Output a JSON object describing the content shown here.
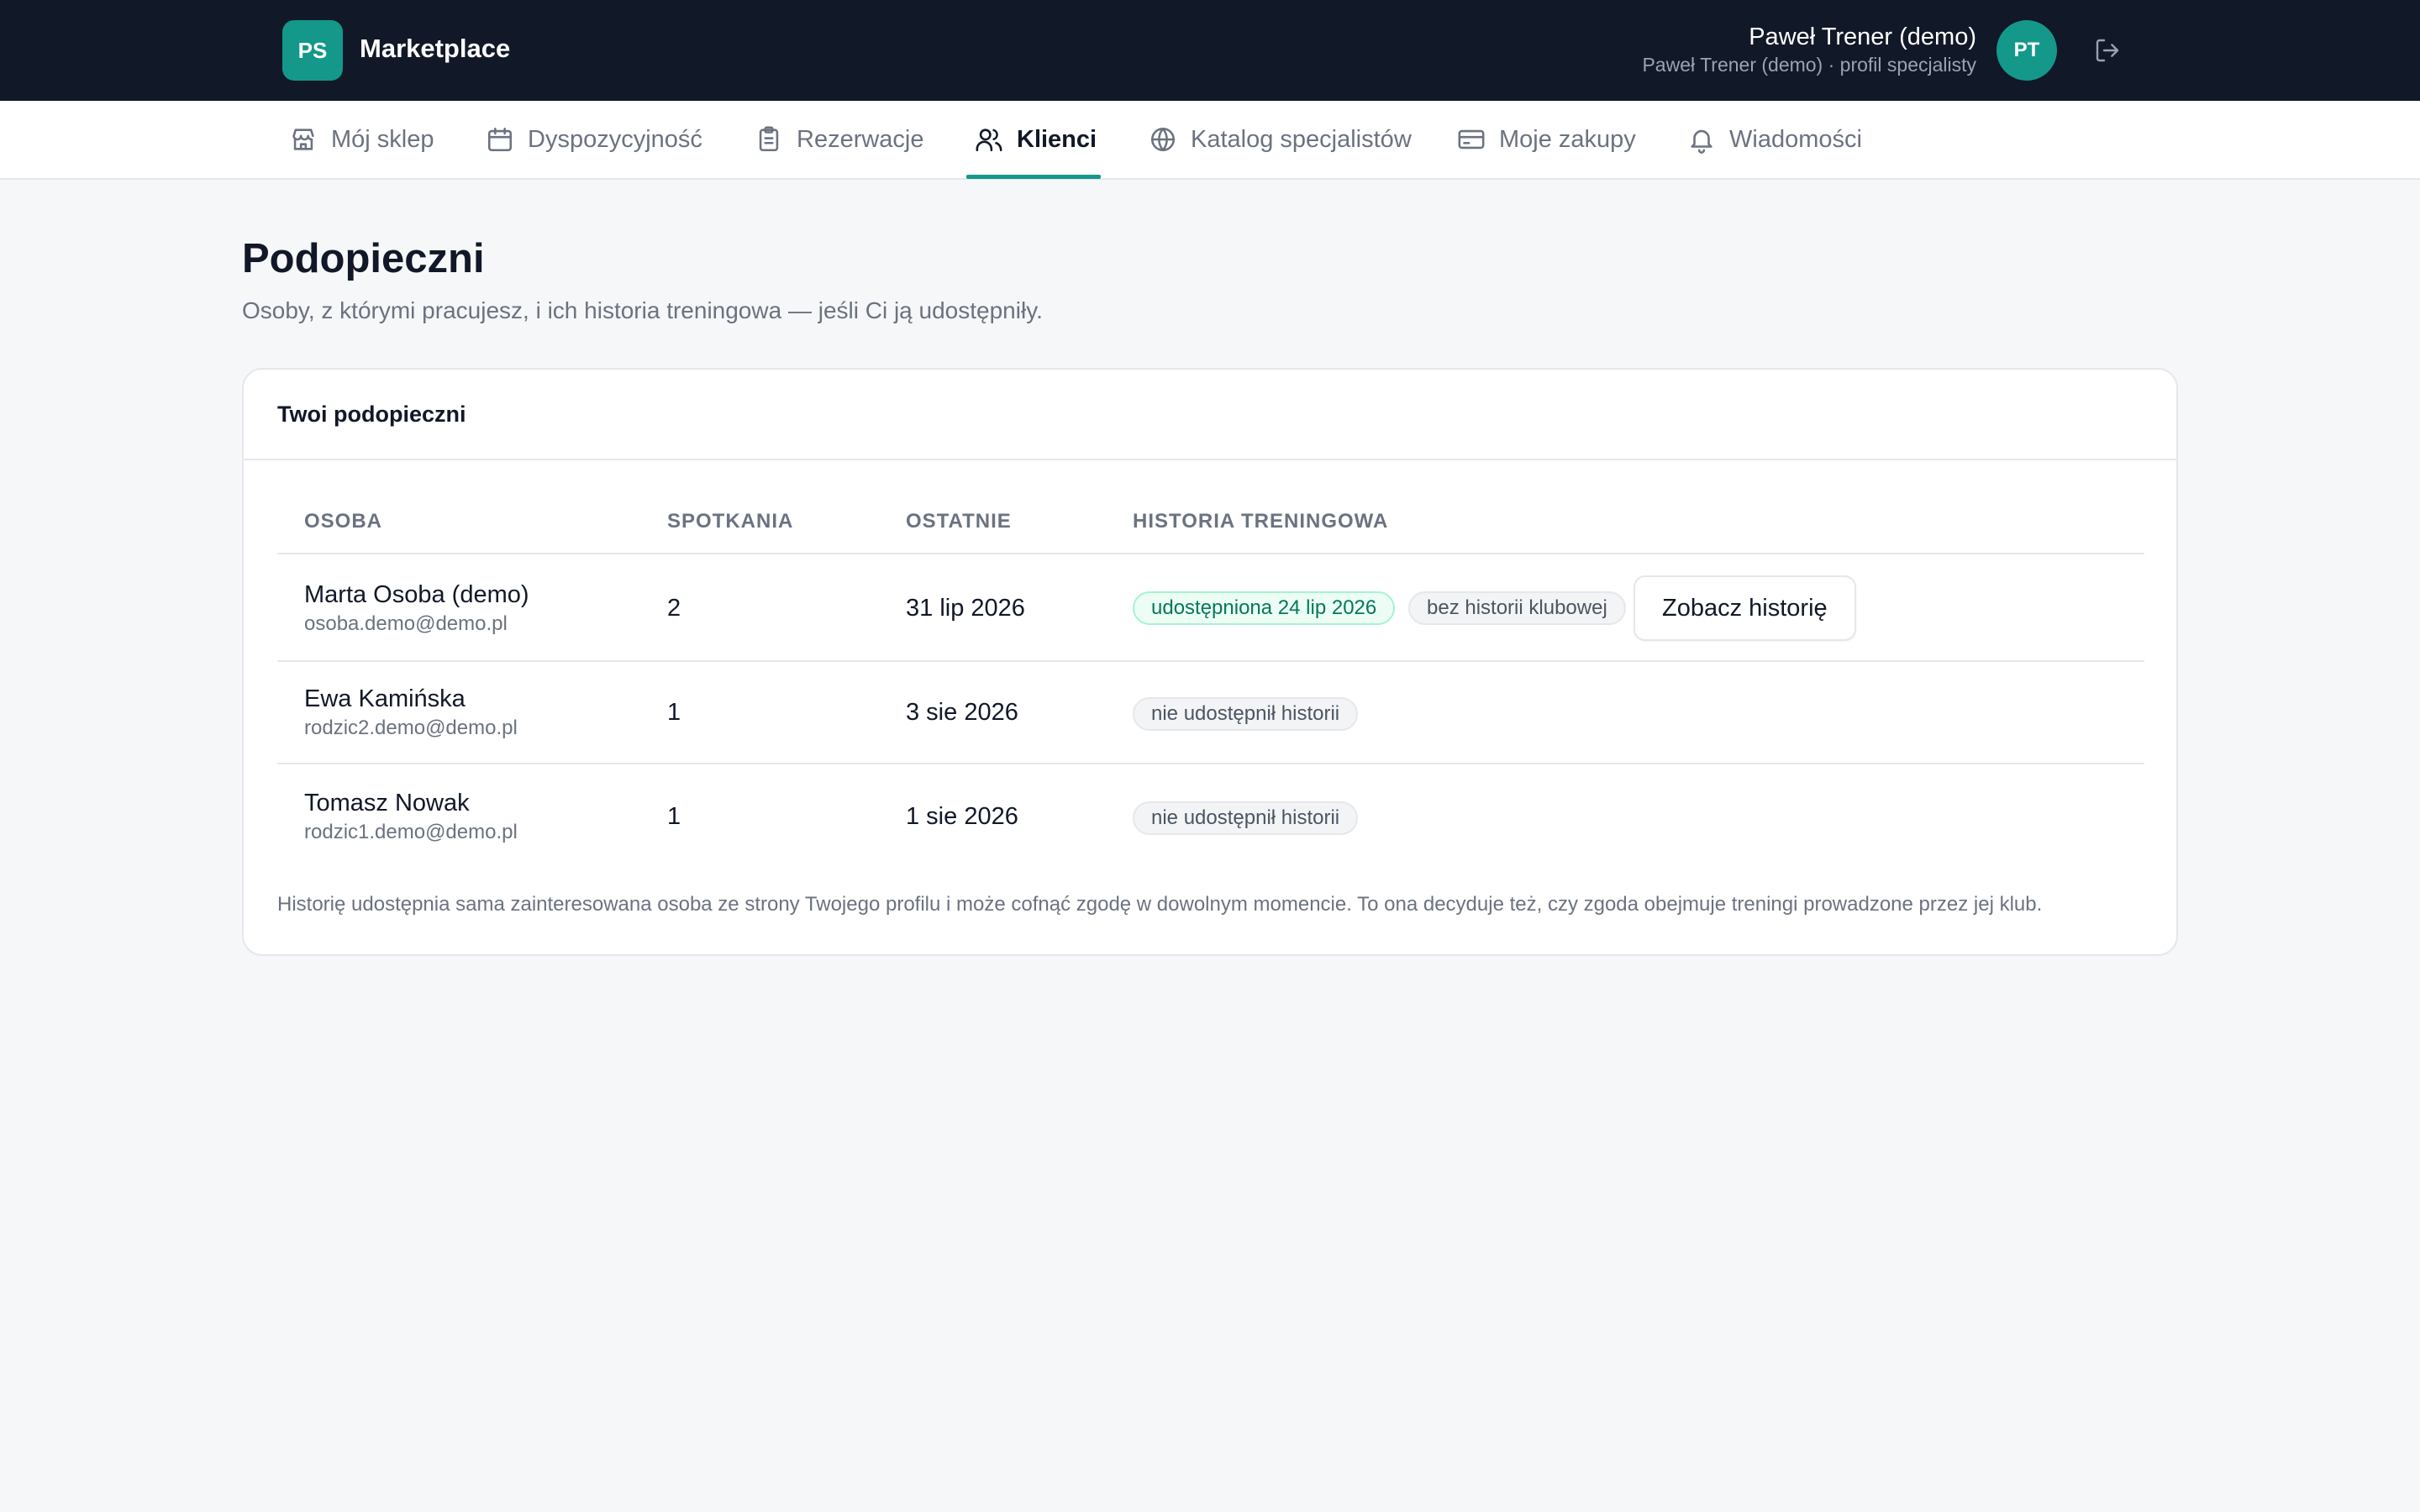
{
  "header": {
    "logo_initials": "PS",
    "brand": "Marketplace",
    "user_name": "Paweł Trener (demo)",
    "user_subtitle": "Paweł Trener (demo) · profil specjalisty",
    "avatar_initials": "PT",
    "logout_icon": "logout-icon"
  },
  "nav": {
    "items": [
      {
        "label": "Mój sklep",
        "icon": "store-icon"
      },
      {
        "label": "Dyspozycyjność",
        "icon": "calendar-icon"
      },
      {
        "label": "Rezerwacje",
        "icon": "clipboard-icon"
      },
      {
        "label": "Klienci",
        "icon": "users-icon",
        "active": true
      },
      {
        "label": "Katalog specjalistów",
        "icon": "globe-icon"
      },
      {
        "label": "Moje zakupy",
        "icon": "credit-card-icon"
      },
      {
        "label": "Wiadomości",
        "icon": "bell-icon"
      }
    ]
  },
  "page": {
    "title": "Podopieczni",
    "subtitle": "Osoby, z którymi pracujesz, i ich historia treningowa — jeśli Ci ją udostępniły."
  },
  "card": {
    "title": "Twoi podopieczni",
    "columns": [
      "OSOBA",
      "SPOTKANIA",
      "OSTATNIE",
      "HISTORIA TRENINGOWA"
    ],
    "rows": [
      {
        "name": "Marta Osoba (demo)",
        "email": "osoba.demo@demo.pl",
        "meetings": "2",
        "last": "31 lip 2026",
        "badges": [
          "udostępniona 24 lip 2026",
          "bez historii klubowej"
        ],
        "action": "Zobacz historię"
      },
      {
        "name": "Ewa Kamińska",
        "email": "rodzic2.demo@demo.pl",
        "meetings": "1",
        "last": "3 sie 2026",
        "badges": [
          "nie udostępnił historii"
        ]
      },
      {
        "name": "Tomasz Nowak",
        "email": "rodzic1.demo@demo.pl",
        "meetings": "1",
        "last": "1 sie 2026",
        "badges": [
          "nie udostępnił historii"
        ]
      }
    ],
    "footnote": "Historię udostępnia sama zainteresowana osoba ze strony Twojego profilu i może cofnąć zgodę w dowolnym momencie. To ona decyduje też, czy zgoda obejmuje treningi prowadzone przez jej klub."
  },
  "colors": {
    "topbar": "#111827",
    "accent": "#13988a",
    "background": "#f6f7f9",
    "shared_badge": "#ecfdf5"
  }
}
